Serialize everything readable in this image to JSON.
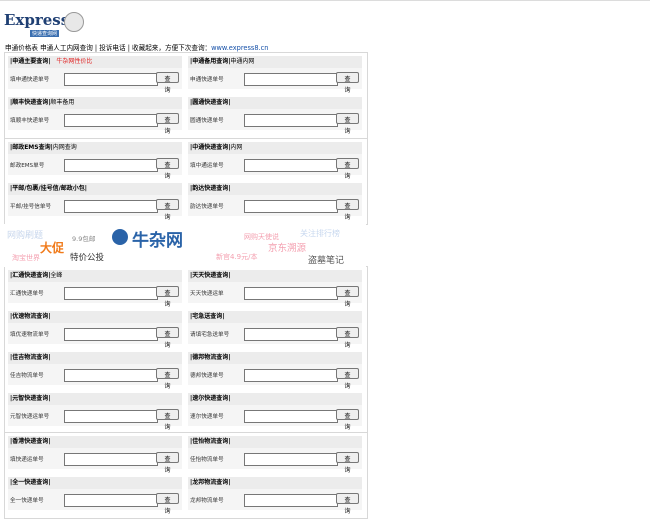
{
  "logo": {
    "text": "Express8",
    "subtitle": "快递查询网"
  },
  "notice": {
    "text": "申通价格表  申通人工内网查询 | 投诉电话 | 收藏起来，方便下次查询：",
    "url": "www.express8.cn"
  },
  "query_button": "查询",
  "blocks": [
    {
      "cells": [
        {
          "title": "|申通主要查询|",
          "extra": "牛杂网性价比",
          "label": "填申通快递单号"
        },
        {
          "title": "|申通备用查询|",
          "extra": "申通内网",
          "label": "申通快递单号"
        },
        {
          "title": "|顺丰快递查询|",
          "extra": "顺丰备用",
          "label": "填顺丰快递单号"
        },
        {
          "title": "|圆通快递查询|",
          "extra": "",
          "label": "圆通快递单号"
        }
      ]
    },
    {
      "cells": [
        {
          "title": "|邮政EMS查询|",
          "extra": "内网查询",
          "label": "邮政EMS单号"
        },
        {
          "title": "|中通快递查询|",
          "extra": "内网",
          "label": "填中通运单号"
        },
        {
          "title": "|平邮/包裹/挂号信/邮政小包|",
          "extra": "",
          "label": "平邮/挂号信单号"
        },
        {
          "title": "|韵达快递查询|",
          "extra": "",
          "label": "韵达快递单号"
        }
      ]
    },
    {
      "cells": [
        {
          "title": "|汇通快递查询|",
          "extra": "全峰",
          "label": "汇通快递单号"
        },
        {
          "title": "|天天快递查询|",
          "extra": "",
          "label": "天天快递运单"
        },
        {
          "title": "|优速物流查询|",
          "extra": "",
          "label": "填优速物流单号"
        },
        {
          "title": "|宅急送查询|",
          "extra": "",
          "label": "请填宅急送单号"
        },
        {
          "title": "|佳吉物流查询|",
          "extra": "",
          "label": "佳吉物流单号"
        },
        {
          "title": "|德邦物流查询|",
          "extra": "",
          "label": "德邦快递单号"
        },
        {
          "title": "|元智快递查询|",
          "extra": "",
          "label": "元智快递运单号"
        },
        {
          "title": "|速尔快递查询|",
          "extra": "",
          "label": "速尔快递单号"
        }
      ]
    },
    {
      "cells": [
        {
          "title": "|香港快递查询|",
          "extra": "",
          "label": "填快递运单号"
        },
        {
          "title": "|佳怡物流查询|",
          "extra": "",
          "label": "佳怡物流单号"
        },
        {
          "title": "|全一快递查询|",
          "extra": "",
          "label": "全一快递单号"
        },
        {
          "title": "|龙邦物流查询|",
          "extra": "",
          "label": "龙邦物流单号"
        }
      ]
    }
  ],
  "banner": {
    "items": [
      "网购刷题",
      "9.9包邮",
      "大促",
      "特价公投",
      "牛杂网",
      "网购天使说",
      "关注排行榜",
      "京东溯源",
      "新官4.9元/本",
      "盗墓笔记",
      "淘宝世界"
    ],
    "colors": {
      "brand": "#2a63a8",
      "orange": "#f07a1a",
      "pink": "#f4a0b0",
      "light": "#c8d8ef"
    }
  },
  "colors": {
    "cell_header": "#ececec",
    "cell_body": "#f5f5f5",
    "accent_red": "#e02020",
    "link": "#1550a8"
  }
}
